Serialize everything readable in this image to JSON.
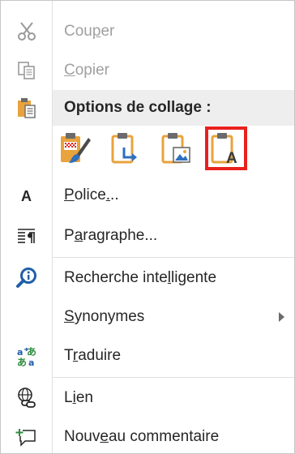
{
  "menu": {
    "cut": {
      "pre": "Cou",
      "u": "p",
      "post": "er"
    },
    "copy": {
      "pre": "",
      "u": "C",
      "post": "opier"
    },
    "paste_header": "Options de collage :",
    "font": {
      "pre": "",
      "u": "P",
      "mid": "olice",
      "u2": ".",
      "post": ".."
    },
    "paragraph": {
      "pre": "P",
      "u": "a",
      "post": "ragraphe..."
    },
    "smart_lookup": {
      "pre": "Recherche inte",
      "u": "l",
      "post": "ligente"
    },
    "synonyms": {
      "pre": "",
      "u": "S",
      "post": "ynonymes"
    },
    "translate": {
      "pre": "T",
      "u": "r",
      "post": "aduire"
    },
    "link": {
      "pre": "L",
      "u": "i",
      "post": "en"
    },
    "new_comment": {
      "pre": "Nouv",
      "u": "e",
      "post": "au commentaire"
    }
  },
  "colors": {
    "selection_outline": "#e8211d",
    "disabled_text": "#a0a0a0",
    "clipboard": "#e8a33d",
    "header_bg": "#eeeeee"
  },
  "icons": [
    "scissors-icon",
    "copy-icon",
    "paste-icon",
    "keep-source-formatting-icon",
    "merge-formatting-icon",
    "paste-picture-icon",
    "keep-text-only-icon",
    "font-icon",
    "paragraph-icon",
    "smart-lookup-icon",
    "translate-icon",
    "link-icon",
    "new-comment-icon",
    "submenu-arrow-icon"
  ]
}
